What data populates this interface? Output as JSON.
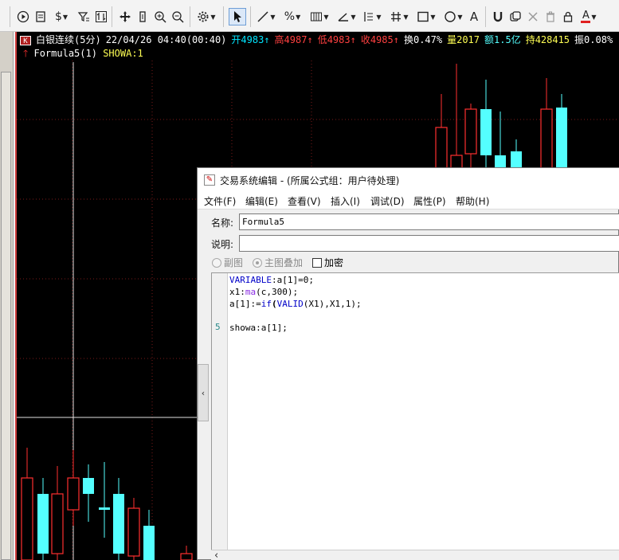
{
  "toolbar": {
    "icons": [
      "play-icon",
      "document-icon",
      "dollar-icon",
      "filter-icon",
      "swap-icon",
      "move-icon",
      "fit-icon",
      "zoom-in-icon",
      "zoom-out-icon",
      "gear-icon",
      "cursor-icon",
      "line-icon",
      "percent-icon",
      "grid-icon",
      "angle-icon",
      "channel-icon",
      "hash-icon",
      "rectangle-icon",
      "circle-icon",
      "text-icon",
      "magnet-icon",
      "copy-icon",
      "close-icon",
      "trash-icon",
      "lock-icon",
      "font-color-icon"
    ],
    "text_icon_label": "A",
    "font_color_label": "A",
    "dollar_label": "$",
    "percent_label": "%"
  },
  "chart": {
    "badge": "K",
    "name": "白银连续(5分)",
    "datetime": "22/04/26 04:40(00:40)",
    "open_label": "开4983",
    "high_label": "高4987",
    "low_label": "低4983",
    "close_label": "收4985",
    "turnover_label": "换0.47%",
    "volume_label": "量2017",
    "amount_label": "额1.5亿",
    "position_label": "持428415",
    "amplitude_label": "振0.08%",
    "formula_name": "Formula5(1)",
    "formula_value": "SHOWA:1",
    "colors": {
      "up": "#ff3030",
      "down": "#54ffff",
      "text": "#c0c0c0",
      "open": "#00e5ff",
      "high": "#ff4040",
      "low": "#ff4040",
      "close": "#ff4040",
      "volume": "#ffff54",
      "amount": "#54ffff",
      "position": "#ffff54"
    }
  },
  "dialog": {
    "title": "交易系统编辑 - (所属公式组：用户待处理)",
    "menu": [
      "文件(F)",
      "编辑(E)",
      "查看(V)",
      "插入(I)",
      "调试(D)",
      "属性(P)",
      "帮助(H)"
    ],
    "name_label": "名称:",
    "name_value": "Formula5",
    "desc_label": "说明:",
    "desc_value": "",
    "options": {
      "sub_chart": "副图",
      "main_overlay": "主图叠加",
      "encrypt": "加密"
    },
    "gutter_line_number": "5",
    "code": {
      "line1_kw": "VARIABLE",
      "line1_rest": ":a[1]=0;",
      "line2_a": "x1:",
      "line2_fn": "ma",
      "line2_rest": "(c,300);",
      "line3_a": "a[1]:=",
      "line3_fn": "if",
      "line3_paren": "(",
      "line3_fn2": "VALID",
      "line3_rest": "(X1),X1,1);",
      "line5": "showa:a[1];"
    },
    "side_tab_label": "‹",
    "scroll_left_label": "‹"
  }
}
